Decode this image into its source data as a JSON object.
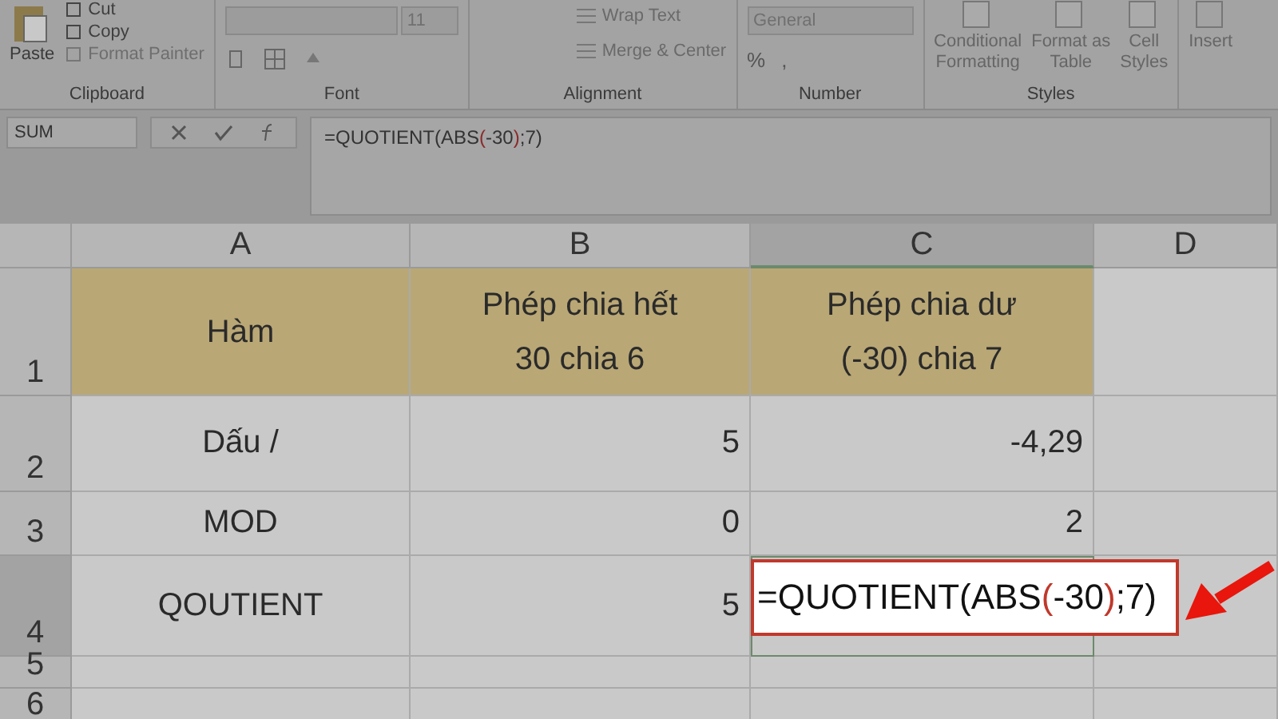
{
  "ribbon": {
    "groups": [
      {
        "kind": "clipboard",
        "label": "Clipboard",
        "paste": "Paste",
        "items": [
          {
            "label": "Cut",
            "disabled": false
          },
          {
            "label": "Copy",
            "disabled": false
          },
          {
            "label": "Format Painter",
            "disabled": true
          }
        ]
      },
      {
        "kind": "font",
        "label": "Font",
        "size": "11"
      },
      {
        "kind": "alignment",
        "label": "Alignment",
        "items": [
          "Wrap Text",
          "Merge & Center"
        ]
      },
      {
        "kind": "number",
        "label": "Number",
        "format": "General",
        "percent": "%",
        "comma": ","
      },
      {
        "kind": "styles",
        "label": "Styles",
        "items": [
          [
            "Conditional",
            "Formatting"
          ],
          [
            "Format as",
            "Table"
          ],
          [
            "Cell",
            "Styles"
          ]
        ]
      },
      {
        "kind": "cells",
        "items": [
          "Insert"
        ]
      }
    ]
  },
  "formula_bar": {
    "name_box": "SUM",
    "formula": [
      {
        "text": "=QUOTIENT(ABS",
        "highlight": false
      },
      {
        "text": "(",
        "highlight": true
      },
      {
        "text": "-30",
        "highlight": false
      },
      {
        "text": ")",
        "highlight": true
      },
      {
        "text": ";7)",
        "highlight": false
      }
    ]
  },
  "sheet": {
    "columns": [
      {
        "label": "A",
        "selected": false
      },
      {
        "label": "B",
        "selected": false
      },
      {
        "label": "C",
        "selected": true
      },
      {
        "label": "D",
        "selected": false
      }
    ],
    "rows": [
      {
        "number": "1",
        "selected": false,
        "kind": "heading",
        "cells": [
          [
            "Hàm"
          ],
          [
            "Phép chia hết",
            "30 chia 6"
          ],
          [
            "Phép chia dư",
            "(-30) chia 7"
          ]
        ]
      },
      {
        "number": "2",
        "selected": false,
        "kind": "data",
        "cells": [
          [
            "Dấu /"
          ],
          [
            "5"
          ],
          [
            "-4,29"
          ]
        ]
      },
      {
        "number": "3",
        "selected": false,
        "kind": "data",
        "cells": [
          [
            "MOD"
          ],
          [
            "0"
          ],
          [
            "2"
          ]
        ]
      },
      {
        "number": "4",
        "selected": true,
        "kind": "editing",
        "cells": [
          [
            "QOUTIENT"
          ],
          [
            "5"
          ]
        ],
        "editing": [
          {
            "text": "=QUOTIENT(ABS",
            "highlight": false
          },
          {
            "text": "(",
            "highlight": true
          },
          {
            "text": "-30",
            "highlight": false
          },
          {
            "text": ")",
            "highlight": true
          },
          {
            "text": ";7)",
            "highlight": false
          }
        ]
      },
      {
        "number": "5",
        "selected": false,
        "kind": "empty",
        "cells": []
      },
      {
        "number": "6",
        "selected": false,
        "kind": "empty",
        "cells": []
      }
    ]
  }
}
